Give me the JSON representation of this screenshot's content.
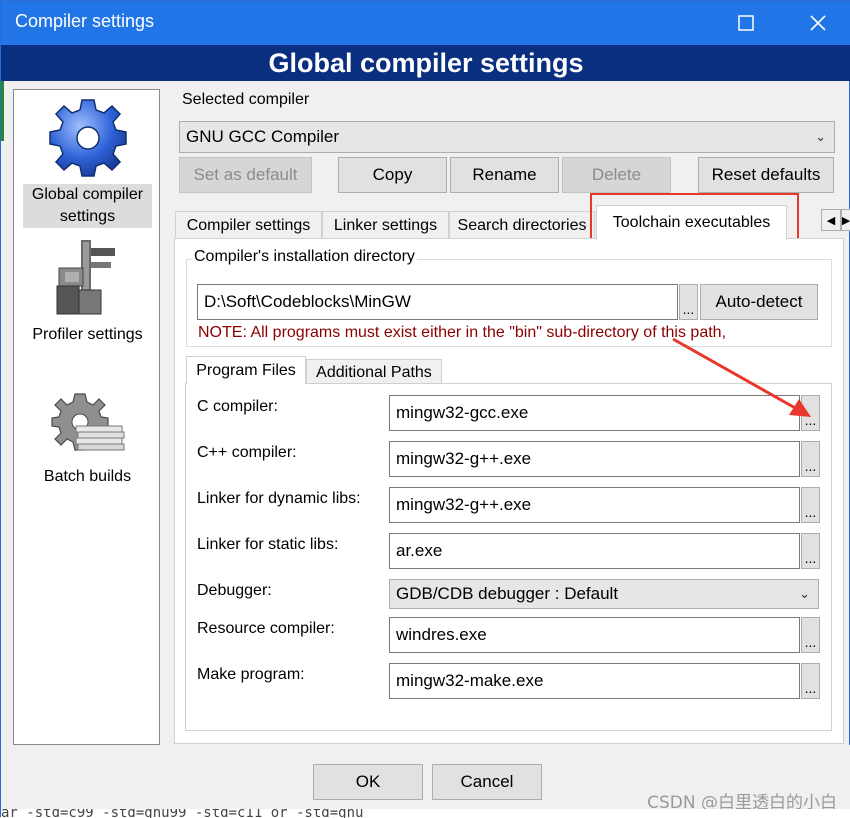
{
  "window": {
    "title": "Compiler settings",
    "banner": "Global compiler settings"
  },
  "nav": [
    {
      "label1": "Global compiler",
      "label2": "settings",
      "icon": "gear-icon"
    },
    {
      "label1": "Profiler settings",
      "icon": "caliper-icon"
    },
    {
      "label1": "Batch builds",
      "icon": "batch-gear-icon"
    }
  ],
  "selected_compiler": {
    "label": "Selected compiler",
    "value": "GNU GCC Compiler",
    "buttons": {
      "set_default": "Set as default",
      "copy": "Copy",
      "rename": "Rename",
      "delete": "Delete",
      "reset": "Reset defaults"
    }
  },
  "tabs": [
    "Compiler settings",
    "Linker settings",
    "Search directories",
    "Toolchain executables"
  ],
  "install": {
    "group_label": "Compiler's installation directory",
    "path": "D:\\Soft\\Codeblocks\\MinGW",
    "dots": "...",
    "autodetect": "Auto-detect",
    "note": "NOTE: All programs must exist either in the \"bin\" sub-directory of this path,"
  },
  "subtabs": [
    "Program Files",
    "Additional Paths"
  ],
  "programs": [
    {
      "label": "C compiler:",
      "value": "mingw32-gcc.exe"
    },
    {
      "label": "C++ compiler:",
      "value": "mingw32-g++.exe"
    },
    {
      "label": "Linker for dynamic libs:",
      "value": "mingw32-g++.exe"
    },
    {
      "label": "Linker for static libs:",
      "value": "ar.exe"
    },
    {
      "label": "Debugger:",
      "value": "GDB/CDB debugger : Default"
    },
    {
      "label": "Resource compiler:",
      "value": "windres.exe"
    },
    {
      "label": "Make program:",
      "value": "mingw32-make.exe"
    }
  ],
  "footer": {
    "ok": "OK",
    "cancel": "Cancel"
  },
  "background_text": "ar  -std=c99  -std=gnu99  -std=c11 or -std=gnu",
  "watermark": "CSDN @白里透白的小白",
  "colors": {
    "titlebar": "#2275e6",
    "banner": "#0a2e80",
    "note": "#8b0000",
    "annotation": "#e8372b"
  }
}
